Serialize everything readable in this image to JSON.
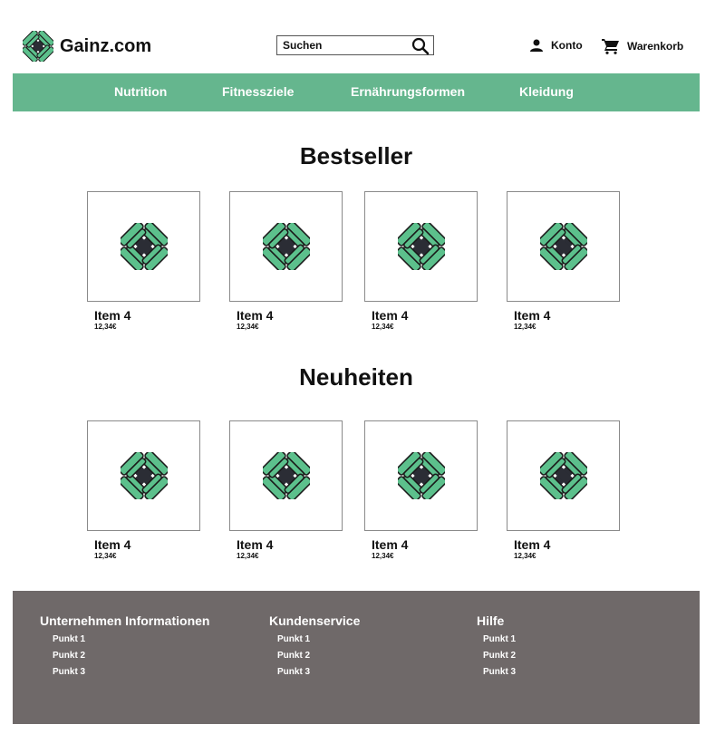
{
  "header": {
    "brand": "Gainz.com",
    "search_placeholder": "Suchen",
    "account_label": "Konto",
    "cart_label": "Warenkorb"
  },
  "nav": {
    "items": [
      {
        "label": "Nutrition"
      },
      {
        "label": "Fitnessziele"
      },
      {
        "label": "Ernährungsformen"
      },
      {
        "label": "Kleidung"
      }
    ]
  },
  "sections": [
    {
      "title": "Bestseller",
      "products": [
        {
          "name": "Item 4",
          "price": "12,34€"
        },
        {
          "name": "Item 4",
          "price": "12,34€"
        },
        {
          "name": "Item 4",
          "price": "12,34€"
        },
        {
          "name": "Item 4",
          "price": "12,34€"
        }
      ]
    },
    {
      "title": "Neuheiten",
      "products": [
        {
          "name": "Item 4",
          "price": "12,34€"
        },
        {
          "name": "Item 4",
          "price": "12,34€"
        },
        {
          "name": "Item 4",
          "price": "12,34€"
        },
        {
          "name": "Item 4",
          "price": "12,34€"
        }
      ]
    }
  ],
  "footer": {
    "columns": [
      {
        "title": "Unternehmen Informationen",
        "links": [
          "Punkt 1",
          "Punkt 2",
          "Punkt 3"
        ]
      },
      {
        "title": "Kundenservice",
        "links": [
          "Punkt 1",
          "Punkt 2",
          "Punkt 3"
        ]
      },
      {
        "title": "Hilfe",
        "links": [
          "Punkt 1",
          "Punkt 2",
          "Punkt 3"
        ]
      }
    ]
  },
  "colors": {
    "accent_green": "#65b68e",
    "footer_gray": "#6f6969",
    "dark_icon": "#2b2d35"
  },
  "icons": {
    "brand": "dumbbell-cross-icon",
    "search": "search-icon",
    "account": "user-icon",
    "cart": "cart-icon",
    "product": "dumbbell-cross-icon"
  }
}
